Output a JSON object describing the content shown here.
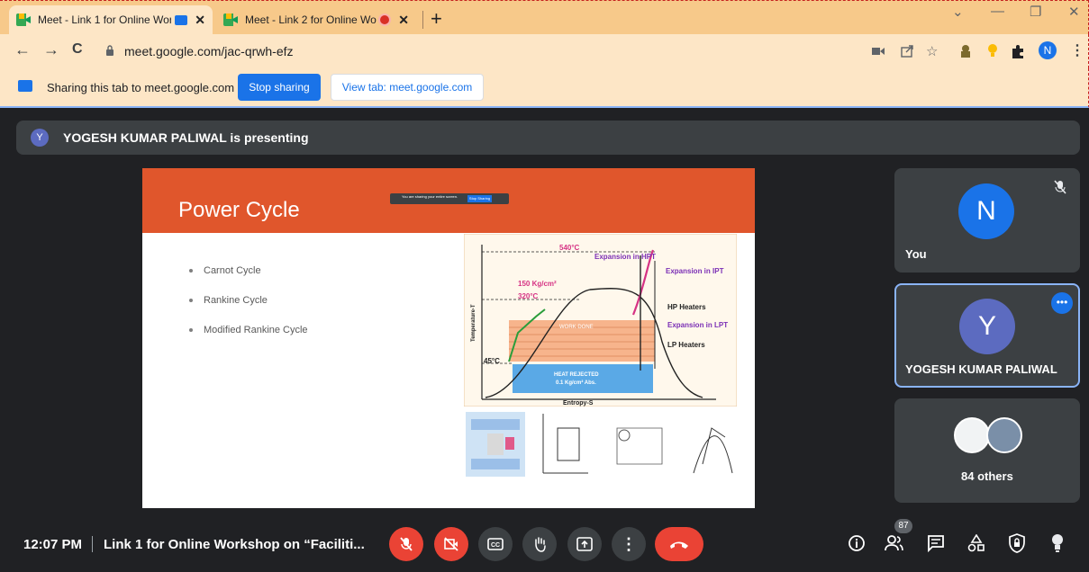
{
  "browser": {
    "tabs": [
      {
        "title": "Meet - Link 1 for Online Wor",
        "close": "✕"
      },
      {
        "title": "Meet - Link 2 for Online Wor",
        "close": "✕"
      }
    ],
    "new_tab": "+",
    "window_controls": {
      "collapse": "⌄",
      "minimize": "—",
      "restore": "❐",
      "close": "✕"
    },
    "nav": {
      "back": "←",
      "forward": "→",
      "reload": "C"
    },
    "url": "meet.google.com/jac-qrwh-efz",
    "profile_initial": "N",
    "toolbar_icons": [
      "video-icon",
      "share-icon",
      "star-icon",
      "extension-icon",
      "bulb-icon",
      "puzzle-icon",
      "menu-icon"
    ]
  },
  "infobar": {
    "text": "Sharing this tab to meet.google.com",
    "stop_label": "Stop sharing",
    "view_label": "View tab: meet.google.com"
  },
  "meet": {
    "presenter_initial": "Y",
    "presenting_text": "YOGESH KUMAR PALIWAL is presenting",
    "slide": {
      "title": "Power Cycle",
      "mini_bar_text": "You are sharing your entire screen.",
      "mini_bar_stop": "Stop Sharing",
      "bullets": [
        "Carnot Cycle",
        "Rankine Cycle",
        "Modified Rankine Cycle"
      ],
      "diagram": {
        "temp_top": "540°C",
        "pressure": "150 Kg/cm²",
        "temp_mid": "320°C",
        "temp_low": "45°C",
        "exp_hpt": "Expansion in HPT",
        "exp_ipt": "Expansion in IPT",
        "hp_heaters": "HP Heaters",
        "exp_lpt": "Expansion in LPT",
        "lp_heaters": "LP Heaters",
        "work_done": "WORK DONE",
        "heat_rejected": "HEAT REJECTED",
        "heat_pressure": "0.1 Kg/cm² Abs.",
        "x_axis": "Entropy-S",
        "y_axis": "Temperature-T"
      }
    },
    "tiles": [
      {
        "initial": "N",
        "name": "You",
        "color": "#1a73e8"
      },
      {
        "initial": "Y",
        "name": "YOGESH KUMAR PALIWAL",
        "color": "#5c6bc0"
      },
      {
        "name": "84 others"
      }
    ],
    "more_dots": "•••",
    "bottom": {
      "time": "12:07 PM",
      "meeting_name": "Link 1 for Online Workshop on “Faciliti...",
      "people_count": "87"
    }
  }
}
